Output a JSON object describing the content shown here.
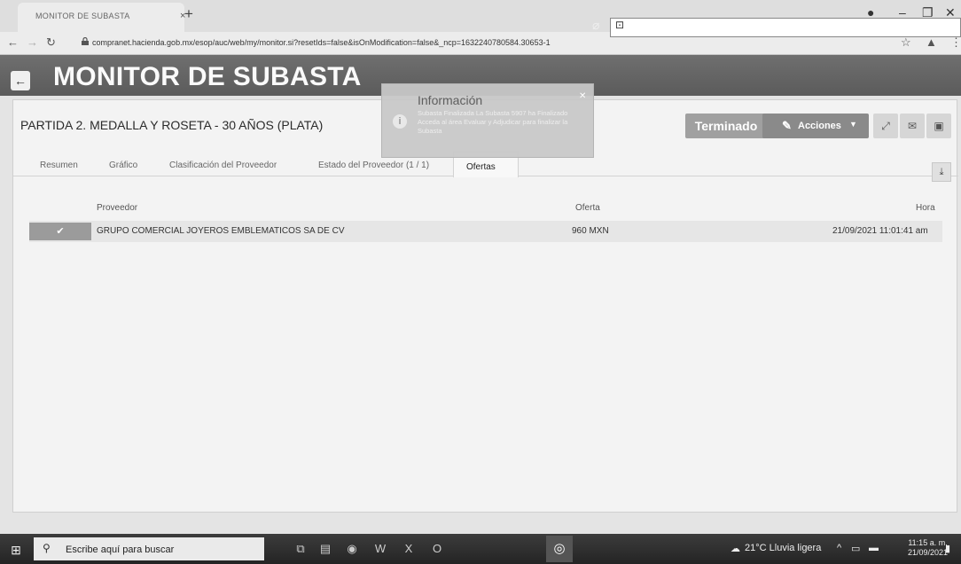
{
  "browser": {
    "tab_title": "MONITOR DE SUBASTA",
    "tab_close": "×",
    "new_tab": "+",
    "url": "compranet.hacienda.gob.mx/esop/auc/web/my/monitor.si?resetIds=false&isOnModification=false&_ncp=1632240780584.30653-1"
  },
  "header": {
    "title": "MONITOR DE SUBASTA"
  },
  "page": {
    "partida_title": "PARTIDA 2. MEDALLA Y ROSETA - 30 AÑOS (PLATA)",
    "status_button": "Terminado",
    "actions_button": "Acciones"
  },
  "tabs": [
    {
      "label": "Resumen"
    },
    {
      "label": "Gráfico"
    },
    {
      "label": "Clasificación del Proveedor"
    },
    {
      "label": "Estado del Proveedor (1 / 1)"
    },
    {
      "label": "Ofertas"
    }
  ],
  "table": {
    "columns": {
      "proveedor": "Proveedor",
      "oferta": "Oferta",
      "hora": "Hora"
    },
    "rows": [
      {
        "proveedor": "GRUPO COMERCIAL JOYEROS EMBLEMATICOS SA DE CV",
        "oferta": "960 MXN",
        "hora": "21/09/2021 11:01:41 am"
      }
    ]
  },
  "popup": {
    "title": "Información",
    "message": "Subasta Finalizada La Subasta 5907 ha Finalizado Acceda al área Evaluar y Adjudicar para finalizar la Subasta"
  },
  "taskbar": {
    "search_placeholder": "Escribe aquí para buscar",
    "weather": "21°C  Lluvia ligera",
    "time": "11:15 a. m.",
    "date": "21/09/2021"
  }
}
